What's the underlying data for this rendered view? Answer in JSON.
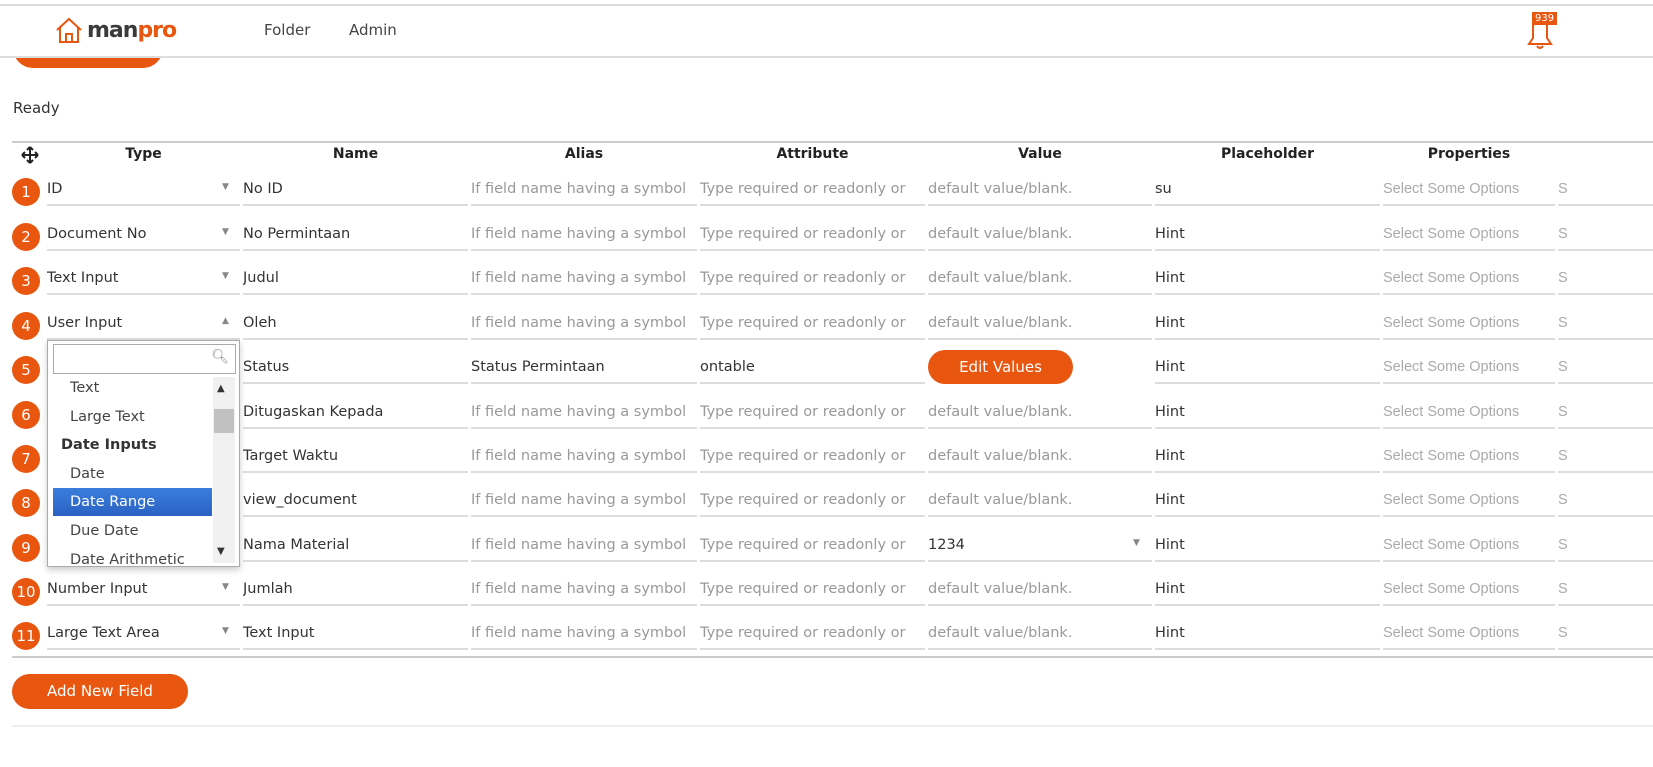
{
  "nav": {
    "logo": "manpro",
    "links": [
      "Folder",
      "Admin"
    ],
    "notifications": "939"
  },
  "status": "Ready",
  "columns": [
    "Type",
    "Name",
    "Alias",
    "Attribute",
    "Value",
    "Placeholder",
    "Properties"
  ],
  "rows": [
    {
      "n": "1",
      "type": "ID",
      "name": "No ID",
      "alias": "If field name having a symbol",
      "attribute": "Type required or readonly or",
      "value": "default value/blank.",
      "placeholder": "su",
      "properties": "Select Some Options",
      "extra": "S"
    },
    {
      "n": "2",
      "type": "Document No",
      "name": "No Permintaan",
      "alias": "If field name having a symbol",
      "attribute": "Type required or readonly or",
      "value": "default value/blank.",
      "placeholder": "Hint",
      "properties": "Select Some Options",
      "extra": "S"
    },
    {
      "n": "3",
      "type": "Text Input",
      "name": "Judul",
      "alias": "If field name having a symbol",
      "attribute": "Type required or readonly or",
      "value": "default value/blank.",
      "placeholder": "Hint",
      "properties": "Select Some Options",
      "extra": "S"
    },
    {
      "n": "4",
      "type": "User Input",
      "name": "Oleh",
      "alias": "If field name having a symbol",
      "attribute": "Type required or readonly or",
      "value": "default value/blank.",
      "placeholder": "Hint",
      "properties": "Select Some Options",
      "extra": "S"
    },
    {
      "n": "5",
      "type": "",
      "name": "Status",
      "alias": "Status Permintaan",
      "attribute": "ontable",
      "value": "Edit Values",
      "placeholder": "Hint",
      "properties": "Select Some Options",
      "extra": "S"
    },
    {
      "n": "6",
      "type": "",
      "name": "Ditugaskan Kepada",
      "alias": "If field name having a symbol",
      "attribute": "Type required or readonly or",
      "value": "default value/blank.",
      "placeholder": "Hint",
      "properties": "Select Some Options",
      "extra": "S"
    },
    {
      "n": "7",
      "type": "",
      "name": "Target Waktu",
      "alias": "If field name having a symbol",
      "attribute": "Type required or readonly or",
      "value": "default value/blank.",
      "placeholder": "Hint",
      "properties": "Select Some Options",
      "extra": "S"
    },
    {
      "n": "8",
      "type": "",
      "name": "view_document",
      "alias": "If field name having a symbol",
      "attribute": "Type required or readonly or",
      "value": "default value/blank.",
      "placeholder": "Hint",
      "properties": "Select Some Options",
      "extra": "S"
    },
    {
      "n": "9",
      "type": "",
      "name": "Nama Material",
      "alias": "If field name having a symbol",
      "attribute": "Type required or readonly or",
      "value": "1234",
      "placeholder": "Hint",
      "properties": "Select Some Options",
      "extra": "S"
    },
    {
      "n": "10",
      "type": "Number Input",
      "name": "Jumlah",
      "alias": "If field name having a symbol",
      "attribute": "Type required or readonly or",
      "value": "default value/blank.",
      "placeholder": "Hint",
      "properties": "Select Some Options",
      "extra": "S"
    },
    {
      "n": "11",
      "type": "Large Text Area",
      "name": "Text Input",
      "alias": "If field name having a symbol",
      "attribute": "Type required or readonly or",
      "value": "default value/blank.",
      "placeholder": "Hint",
      "properties": "Select Some Options",
      "extra": "S"
    }
  ],
  "dropdown": {
    "search_value": "",
    "items": [
      {
        "label": "Text",
        "group": false,
        "selected": false
      },
      {
        "label": "Large Text",
        "group": false,
        "selected": false
      },
      {
        "label": "Date Inputs",
        "group": true,
        "selected": false
      },
      {
        "label": "Date",
        "group": false,
        "selected": false
      },
      {
        "label": "Date Range",
        "group": false,
        "selected": true
      },
      {
        "label": "Due Date",
        "group": false,
        "selected": false
      },
      {
        "label": "Date Arithmetic",
        "group": false,
        "selected": false
      }
    ]
  },
  "add_button": "Add New Field",
  "colors": {
    "accent": "#e8560f",
    "selected": "#2f6fd0"
  }
}
